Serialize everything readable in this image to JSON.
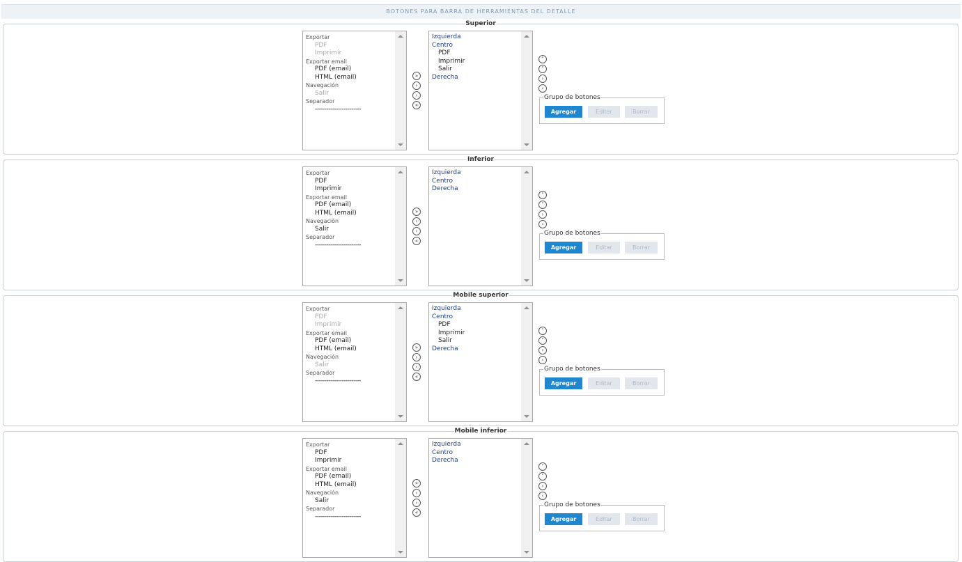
{
  "header": {
    "title": "BOTONES PARA BARRA DE HERRAMIENTAS DEL DETALLE"
  },
  "sections": [
    {
      "title": "Superior",
      "available": [
        {
          "label": "Exportar",
          "kind": "group"
        },
        {
          "label": "PDF",
          "kind": "child",
          "disabled": true
        },
        {
          "label": "Imprimir",
          "kind": "child",
          "disabled": true
        },
        {
          "label": "Exportar email",
          "kind": "group"
        },
        {
          "label": "PDF (email)",
          "kind": "child",
          "disabled": false
        },
        {
          "label": "HTML (email)",
          "kind": "child",
          "disabled": false
        },
        {
          "label": "Navegación",
          "kind": "group"
        },
        {
          "label": "Salir",
          "kind": "child",
          "disabled": true
        },
        {
          "label": "Separador",
          "kind": "group"
        },
        {
          "label": "------------------------",
          "kind": "sep"
        }
      ],
      "selected": [
        {
          "label": "Izquierda",
          "kind": "zone"
        },
        {
          "label": "Centro",
          "kind": "zone"
        },
        {
          "label": "PDF",
          "kind": "zchild"
        },
        {
          "label": "Imprimir",
          "kind": "zchild"
        },
        {
          "label": "Salir",
          "kind": "zchild"
        },
        {
          "label": "Derecha",
          "kind": "zone"
        }
      ]
    },
    {
      "title": "Inferior",
      "available": [
        {
          "label": "Exportar",
          "kind": "group"
        },
        {
          "label": "PDF",
          "kind": "child",
          "disabled": false
        },
        {
          "label": "Imprimir",
          "kind": "child",
          "disabled": false
        },
        {
          "label": "Exportar email",
          "kind": "group"
        },
        {
          "label": "PDF (email)",
          "kind": "child",
          "disabled": false
        },
        {
          "label": "HTML (email)",
          "kind": "child",
          "disabled": false
        },
        {
          "label": "Navegación",
          "kind": "group"
        },
        {
          "label": "Salir",
          "kind": "child",
          "disabled": false
        },
        {
          "label": "Separador",
          "kind": "group"
        },
        {
          "label": "------------------------",
          "kind": "sep"
        }
      ],
      "selected": [
        {
          "label": "Izquierda",
          "kind": "zone"
        },
        {
          "label": "Centro",
          "kind": "zone"
        },
        {
          "label": "Derecha",
          "kind": "zone"
        }
      ]
    },
    {
      "title": "Mobile superior",
      "available": [
        {
          "label": "Exportar",
          "kind": "group"
        },
        {
          "label": "PDF",
          "kind": "child",
          "disabled": true
        },
        {
          "label": "Imprimir",
          "kind": "child",
          "disabled": true
        },
        {
          "label": "Exportar email",
          "kind": "group"
        },
        {
          "label": "PDF (email)",
          "kind": "child",
          "disabled": false
        },
        {
          "label": "HTML (email)",
          "kind": "child",
          "disabled": false
        },
        {
          "label": "Navegación",
          "kind": "group"
        },
        {
          "label": "Salir",
          "kind": "child",
          "disabled": true
        },
        {
          "label": "Separador",
          "kind": "group"
        },
        {
          "label": "------------------------",
          "kind": "sep"
        }
      ],
      "selected": [
        {
          "label": "Izquierda",
          "kind": "zone"
        },
        {
          "label": "Centro",
          "kind": "zone"
        },
        {
          "label": "PDF",
          "kind": "zchild"
        },
        {
          "label": "Imprimir",
          "kind": "zchild"
        },
        {
          "label": "Salir",
          "kind": "zchild"
        },
        {
          "label": "Derecha",
          "kind": "zone"
        }
      ]
    },
    {
      "title": "Mobile inferior",
      "available": [
        {
          "label": "Exportar",
          "kind": "group"
        },
        {
          "label": "PDF",
          "kind": "child",
          "disabled": false
        },
        {
          "label": "Imprimir",
          "kind": "child",
          "disabled": false
        },
        {
          "label": "Exportar email",
          "kind": "group"
        },
        {
          "label": "PDF (email)",
          "kind": "child",
          "disabled": false
        },
        {
          "label": "HTML (email)",
          "kind": "child",
          "disabled": false
        },
        {
          "label": "Navegación",
          "kind": "group"
        },
        {
          "label": "Salir",
          "kind": "child",
          "disabled": false
        },
        {
          "label": "Separador",
          "kind": "group"
        },
        {
          "label": "------------------------",
          "kind": "sep"
        }
      ],
      "selected": [
        {
          "label": "Izquierda",
          "kind": "zone"
        },
        {
          "label": "Centro",
          "kind": "zone"
        },
        {
          "label": "Derecha",
          "kind": "zone"
        }
      ]
    }
  ],
  "move_buttons": [
    {
      "name": "move-all-right-button",
      "glyph": "»"
    },
    {
      "name": "move-right-button",
      "glyph": "›"
    },
    {
      "name": "move-left-button",
      "glyph": "‹"
    },
    {
      "name": "move-all-left-button",
      "glyph": "«"
    }
  ],
  "order_buttons": [
    {
      "name": "move-up-button",
      "glyph": "˄"
    },
    {
      "name": "move-down-button",
      "glyph": "˅"
    },
    {
      "name": "next-button",
      "glyph": "›"
    },
    {
      "name": "previous-button",
      "glyph": "‹"
    }
  ],
  "group_box": {
    "legend": "Grupo de botones",
    "add_label": "Agregar",
    "edit_label": "Editar",
    "delete_label": "Borrar"
  },
  "colors": {
    "accent": "#1f86d0",
    "zone_text": "#1f3f83",
    "disabled_text": "#aaaaaa"
  }
}
